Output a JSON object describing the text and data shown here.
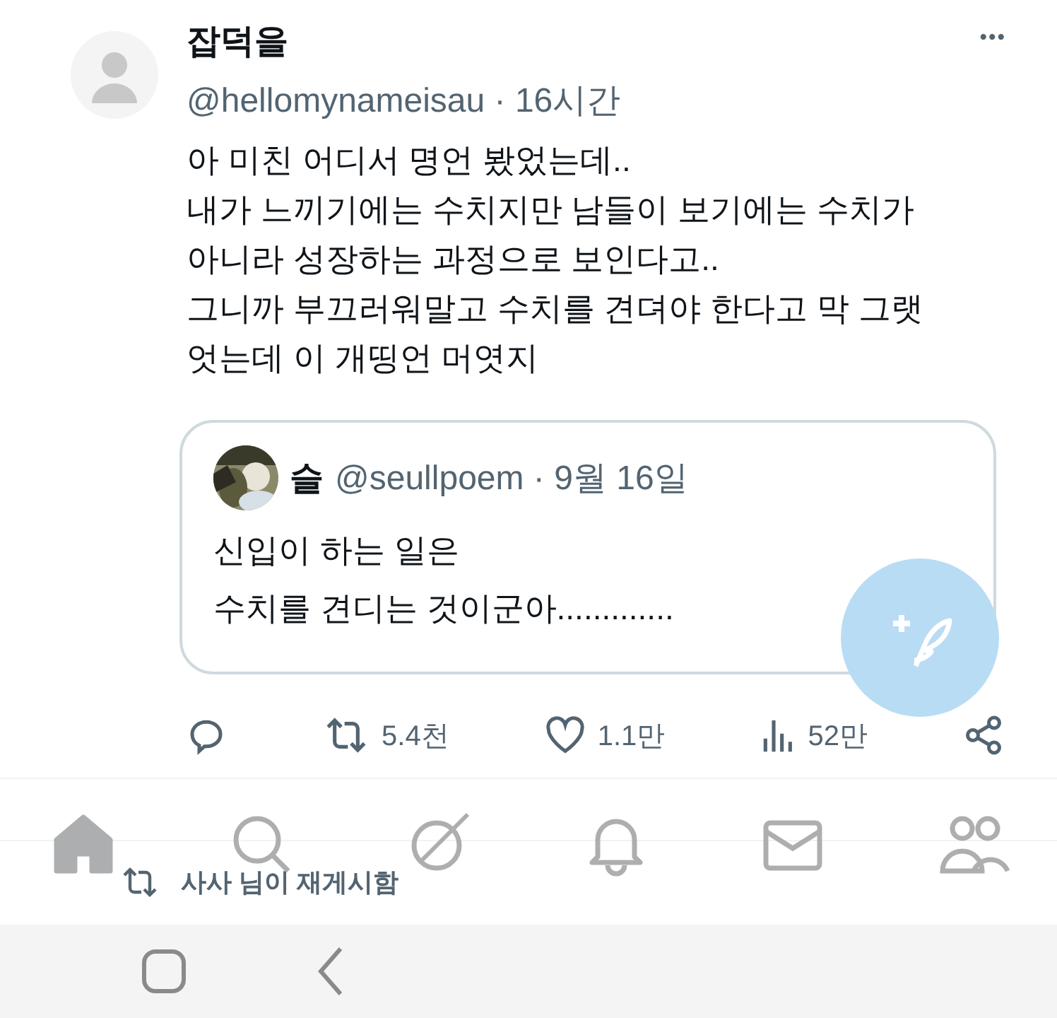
{
  "post": {
    "author": "잡덕을",
    "meta": "@hellomynameisau · 16시간",
    "more": "•••",
    "body": "아 미친 어디서 명언 봤었는데..\n내가 느끼기에는 수치지만 남들이 보기에는 수치가\n아니라 성장하는 과정으로 보인다고..\n그니까 부끄러워말고 수치를 견뎌야 한다고 막 그랫\n엇는데 이 개띵언 머엿지",
    "quote": {
      "author": "슬",
      "meta": "@seullpoem · 9월 16일",
      "body": "신입이 하는 일은\n수치를 견디는 것이군아............."
    },
    "actions": [
      {
        "kind": "reply"
      },
      {
        "kind": "repost",
        "count": "5.4천"
      },
      {
        "kind": "like",
        "count": "1.1만"
      },
      {
        "kind": "views",
        "count": "52만"
      },
      {
        "kind": "share"
      }
    ]
  },
  "next_post": {
    "repost_label": "사사 님이 재게시함"
  },
  "tab_bar": [
    {
      "kind": "home",
      "selected": true
    },
    {
      "kind": "search",
      "selected": false
    },
    {
      "kind": "grok",
      "selected": false
    },
    {
      "kind": "notifications",
      "selected": false
    },
    {
      "kind": "messages",
      "selected": false
    },
    {
      "kind": "communities",
      "selected": false
    }
  ],
  "system_nav": [
    {
      "kind": "recents"
    },
    {
      "kind": "back"
    }
  ]
}
